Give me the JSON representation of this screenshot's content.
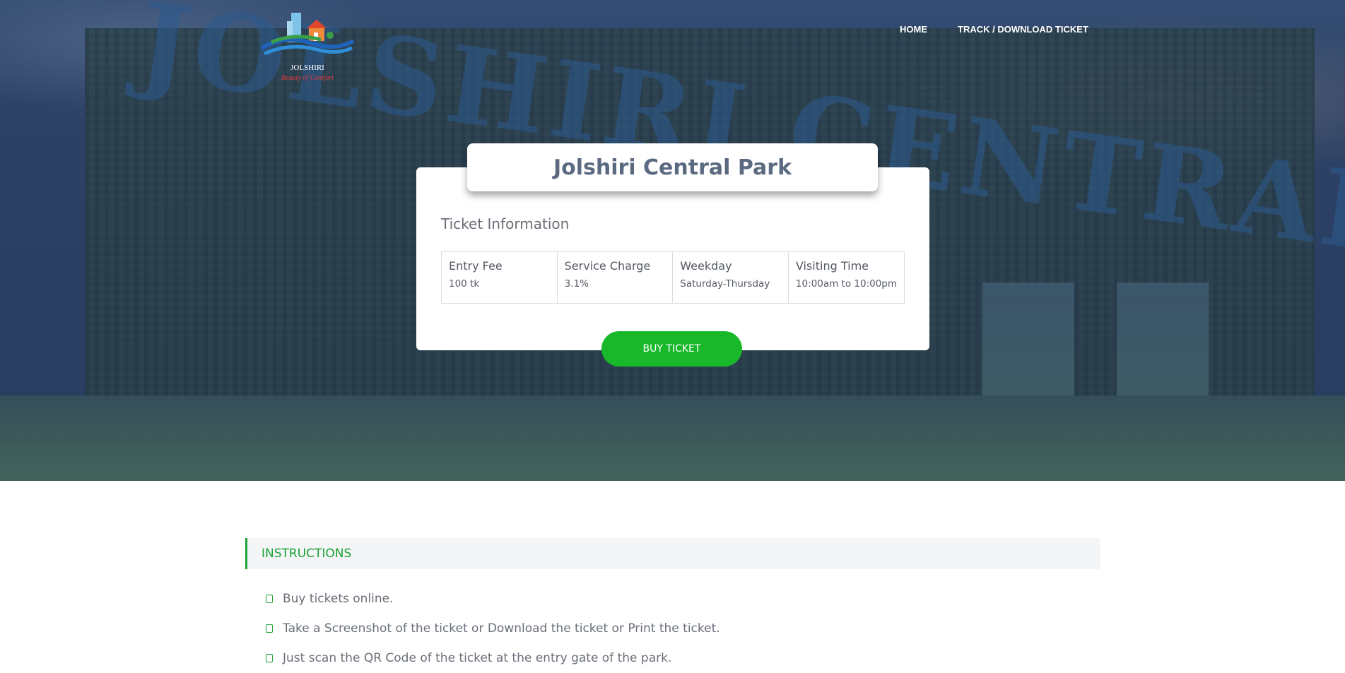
{
  "header": {
    "logo_text": "JOLSHIRI",
    "logo_tagline": "Beauty of Comfort",
    "nav": [
      {
        "label": "HOME"
      },
      {
        "label": "TRACK / DOWNLOAD TICKET"
      }
    ]
  },
  "hero": {
    "sign_text": "JOLSHIRI CENTRAL PARK"
  },
  "card": {
    "title": "Jolshiri Central Park",
    "section_title": "Ticket Information",
    "info": [
      {
        "head": "Entry Fee",
        "value": "100 tk"
      },
      {
        "head": "Service Charge",
        "value": "3.1%"
      },
      {
        "head": "Weekday",
        "value": "Saturday-Thursday"
      },
      {
        "head": "Visiting Time",
        "value": "10:00am to 10:00pm"
      }
    ],
    "buy_label": "BUY TICKET"
  },
  "instructions": {
    "title": "INSTRUCTIONS",
    "items": [
      "Buy tickets online.",
      "Take a Screenshot of the ticket or Download the ticket or Print the ticket.",
      "Just scan the QR Code of the ticket at the entry gate of the park."
    ]
  },
  "colors": {
    "accent_green": "#18b82a",
    "instructions_green": "#1aa234",
    "title_text": "#5b6a80"
  }
}
